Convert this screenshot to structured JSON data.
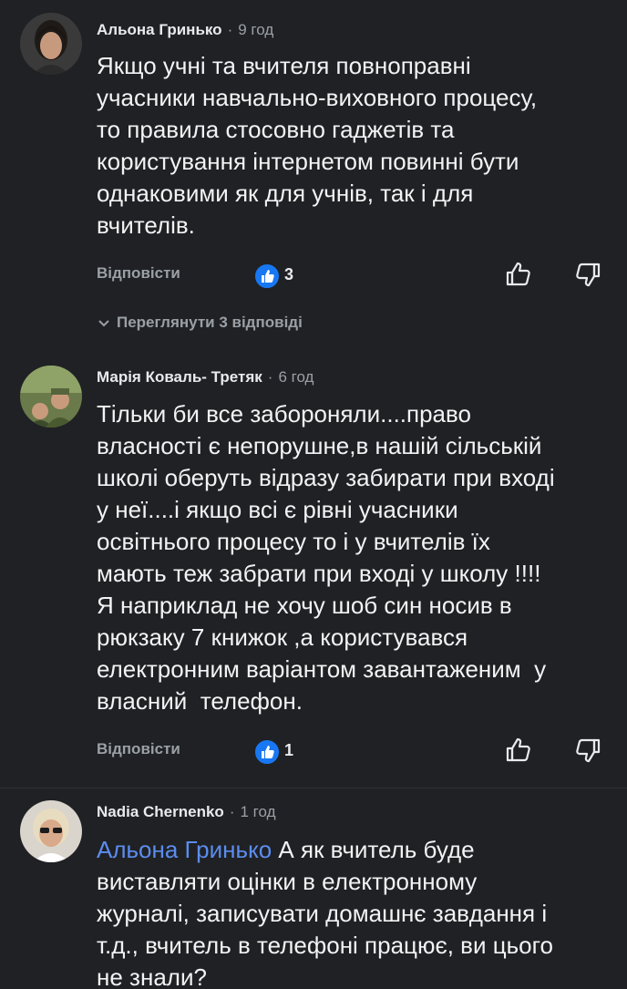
{
  "comments": [
    {
      "author": "Альона Гринько",
      "time": "9 год",
      "text": "Якщо учні та вчителя повноправні\nучасники навчально-виховного процесу,\nто правила стосовно гаджетів та\nкористування інтернетом повинні бути\nоднаковими як для учнів, так і для\nвчителів.",
      "reply_label": "Відповісти",
      "likes": "3",
      "view_replies": "Переглянути 3 відповіді"
    },
    {
      "author": "Марія Коваль- Третяк",
      "time": "6 год",
      "text": "Тільки би все забороняли....право\nвласності є непорушне,в нашій сільській\nшколі оберуть відразу забирати при вході\nу неї....і якщо всі є рівні учасники\nосвітнього процесу то і у вчителів їх\nмають теж забрати при вході у школу !!!!\nЯ наприклад не хочу шоб син носив в\nрюкзаку 7 книжок ,а користувався\nелектронним варіантом завантаженим  у\nвласний  телефон.",
      "reply_label": "Відповісти",
      "likes": "1"
    },
    {
      "author": "Nadia Chernenko",
      "time": "1 год",
      "mention": "Альона Гринько",
      "text": " А як вчитель буде\nвиставляти оцінки в електронному\nжурналі, записувати домашнє завдання і\nт.д., вчитель в телефоні працює, ви цього\nне знали?"
    }
  ],
  "separator": "·",
  "icons": {
    "like_badge": "thumbs-up-badge-icon",
    "upvote": "thumbs-up-outline-icon",
    "downvote": "thumbs-down-outline-icon",
    "expand": "chevron-down-icon"
  },
  "colors": {
    "background": "#202124",
    "accent": "#1877f2",
    "mention": "#5b8def",
    "muted": "#9aa0a6"
  }
}
